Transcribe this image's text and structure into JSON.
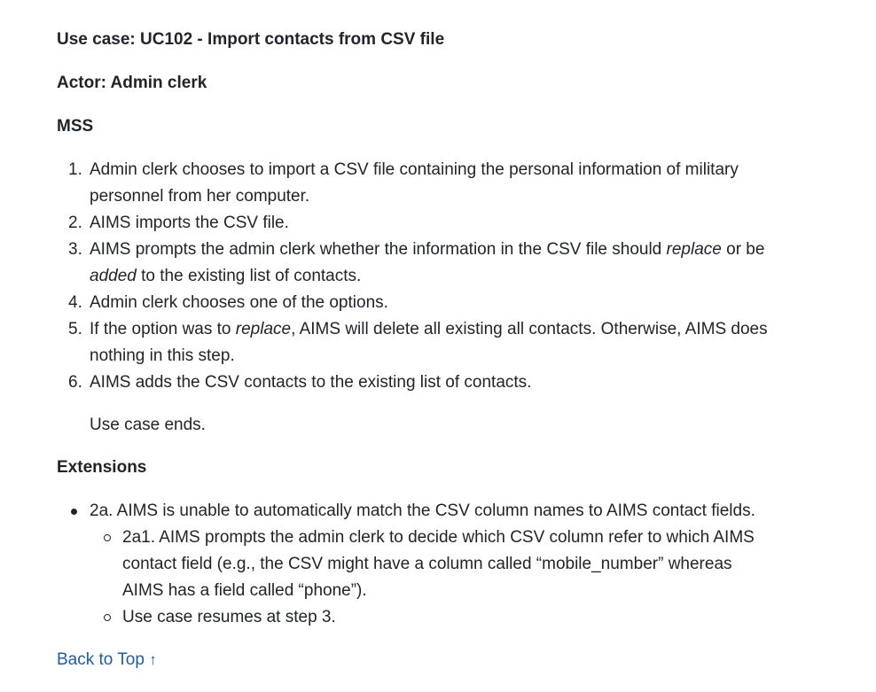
{
  "use_case_title": "Use case: UC102 - Import contacts from CSV file",
  "actor": "Actor: Admin clerk",
  "mss_heading": "MSS",
  "mss_steps": [
    {
      "num": "1.",
      "line1": "Admin clerk chooses to import a CSV file containing the personal information of military",
      "line2": "personnel from her computer."
    },
    {
      "num": "2.",
      "text": "AIMS imports the CSV file."
    },
    {
      "num": "3.",
      "pre": "AIMS prompts the admin clerk whether the information in the CSV file should ",
      "em1": "replace",
      "mid": " or be",
      "em2": "added",
      "post": " to the existing list of contacts."
    },
    {
      "num": "4.",
      "text": "Admin clerk chooses one of the options."
    },
    {
      "num": "5.",
      "pre": "If the option was to ",
      "em1": "replace",
      "post": ", AIMS will delete all existing all contacts. Otherwise, AIMS does",
      "line2": "nothing in this step."
    },
    {
      "num": "6.",
      "text": "AIMS adds the CSV contacts to the existing list of contacts."
    }
  ],
  "use_case_ends": "Use case ends.",
  "extensions_heading": "Extensions",
  "extensions": {
    "item": "2a. AIMS is unable to automatically match the CSV column names to AIMS contact fields.",
    "sub_items": [
      {
        "line1": "2a1. AIMS prompts the admin clerk to decide which CSV column refer to which AIMS",
        "line2": "contact field (e.g., the CSV might have a column called “mobile_number” whereas",
        "line3": "AIMS has a field called “phone”)."
      },
      {
        "line1": "Use case resumes at step 3."
      }
    ]
  },
  "back_to_top": {
    "label": "Back to Top",
    "arrow": "↑"
  }
}
